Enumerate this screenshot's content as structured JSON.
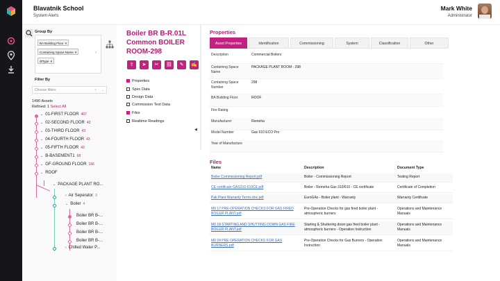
{
  "header": {
    "school": "Blavatnik School",
    "subtitle": "System Alerts",
    "user_name": "Mark White",
    "user_role": "Administrator"
  },
  "group_by": {
    "label": "Group By",
    "chips": [
      "BA Building Floor",
      "Containing Space Name",
      "dtType"
    ]
  },
  "filter": {
    "label": "Filter By",
    "placeholder": "Choose filters",
    "assets_count": "1490 Assets",
    "refined_prefix": "Refined: 1",
    "select_all": "Select All"
  },
  "tree": [
    {
      "label": "01-FIRST FLOOR",
      "count": "467"
    },
    {
      "label": "02-SECOND FLOOR",
      "count": "43"
    },
    {
      "label": "03-THIRD FLOOR",
      "count": "43"
    },
    {
      "label": "04-FOURTH FLOOR",
      "count": "43"
    },
    {
      "label": "05-FIFTH FLOOR",
      "count": "43"
    },
    {
      "label": "B-BASEMENT1",
      "count": "68"
    },
    {
      "label": "GF-GROUND FLOOR",
      "count": "166"
    },
    {
      "label": "ROOF",
      "count": ""
    },
    {
      "label": "PACKAGE PLANT RO...",
      "count": ""
    },
    {
      "label": "Air Seperator",
      "count": "3"
    },
    {
      "label": "Boiler",
      "count": "4"
    },
    {
      "label": "Boiler BR B-...",
      "count": ""
    },
    {
      "label": "Boiler BR B-...",
      "count": ""
    },
    {
      "label": "Boiler BR B-...",
      "count": ""
    },
    {
      "label": "Boiler BR B-...",
      "count": ""
    },
    {
      "label": "Chilled Water P...",
      "count": ""
    }
  ],
  "asset": {
    "title": "Boiler BR B-R.01L Common BOILER ROOM-298"
  },
  "nav": [
    {
      "label": "Properties",
      "active": true
    },
    {
      "label": "Spec Data",
      "active": false
    },
    {
      "label": "Design Data",
      "active": false
    },
    {
      "label": "Commission Test Data",
      "active": false
    },
    {
      "label": "Files",
      "active": true
    },
    {
      "label": "Realtime Readings",
      "active": false
    }
  ],
  "properties": {
    "title": "Properties",
    "tabs": [
      "Asset Properties",
      "Identification",
      "Commissioning",
      "System",
      "Classification",
      "Other"
    ],
    "rows": [
      {
        "k": "Description",
        "v": "Commercial Boilers"
      },
      {
        "k": "Containing Space Name",
        "v": "PACKAGE PLANT ROOM - 298"
      },
      {
        "k": "Containing Space Number",
        "v": "298"
      },
      {
        "k": "BA Building Floor",
        "v": "ROOF"
      },
      {
        "k": "Fire Rating",
        "v": ""
      },
      {
        "k": "Manufacturer",
        "v": "Remeha"
      },
      {
        "k": "Model Number",
        "v": "Gas 610 ECO Pro"
      },
      {
        "k": "Year of Manufacture",
        "v": ""
      }
    ]
  },
  "files": {
    "title": "Files",
    "headers": [
      "Name",
      "Description",
      "Document Type"
    ],
    "rows": [
      {
        "name": "Boiler Commissioning Report.pdf",
        "desc": "Boiler - Commissioning Report",
        "type": "Testing Report"
      },
      {
        "name": "CE certificate GAS310-610CE.pdf",
        "desc": "Boiler - Remeha Gas 310/610 - CE certificate",
        "type": "Certificate of Completion"
      },
      {
        "name": "Pak Plant Warranty Terms.doc.pdf",
        "desc": "EuroGAs - Boiler plant - Warranty",
        "type": "Warranty Certificate"
      },
      {
        "name": "M0 17 PRE-OPERATION CHECKS FOR GAS FIRED BOILER PLANT.pdf",
        "desc": "Pre-Operation Checks for gas fired boiler plant - atmospheric burners",
        "type": "Operations and Maintenance Manuals"
      },
      {
        "name": "M0 18 STARTING AND SHUTTING DOWN GAS FIRE BOILER PLANT.pdf",
        "desc": "Starting & Shuttering down gas fired boiler plant - atmospheric burners - Operation Instruction",
        "type": "Operations and Maintenance Manuals"
      },
      {
        "name": "M0 24 PRE OPERATION CHECKS FOR GAS BURNERS.pdf",
        "desc": "Pre-Operation Checks for Gas Burners - Operation Instruction",
        "type": "Operations and Maintenance Manuals"
      }
    ]
  },
  "colors": {
    "accent": "#c2227f",
    "link": "#3a6fb6",
    "rail": "#16161a"
  }
}
